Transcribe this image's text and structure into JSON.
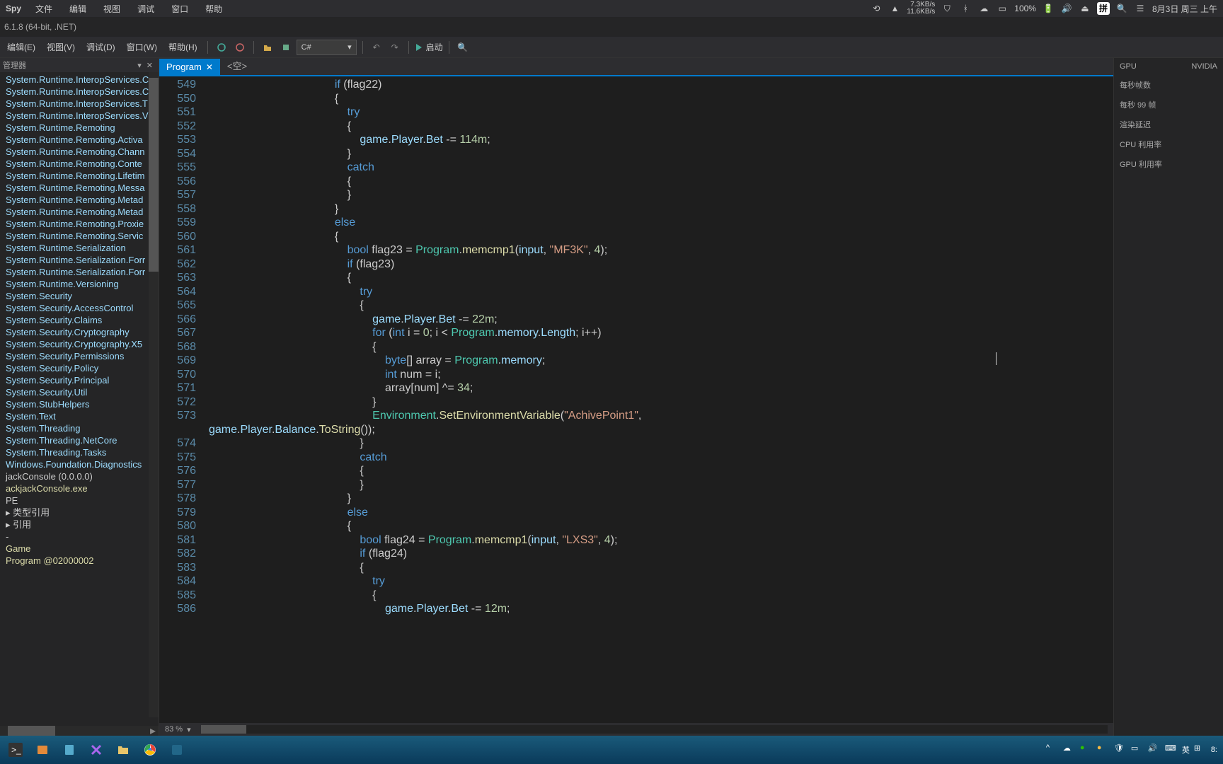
{
  "menubar": {
    "app": "Spy",
    "items": [
      "文件",
      "编辑",
      "视图",
      "调试",
      "窗口",
      "帮助"
    ],
    "net": {
      "up": "7.3KB/s",
      "down": "11.6KB/s"
    },
    "battery": "100%",
    "ime": "拼",
    "date": "8月3日 周三 上午"
  },
  "titlebar": {
    "text": "6.1.8 (64-bit, .NET)"
  },
  "menu2": {
    "items": [
      "编辑(E)",
      "视图(V)",
      "调试(D)",
      "窗口(W)",
      "帮助(H)"
    ],
    "lang": "C#",
    "start": "启动"
  },
  "panel": {
    "title": "管理器",
    "tree": [
      "System.Runtime.InteropServices.C",
      "System.Runtime.InteropServices.C",
      "System.Runtime.InteropServices.T",
      "System.Runtime.InteropServices.V",
      "System.Runtime.Remoting",
      "System.Runtime.Remoting.Activa",
      "System.Runtime.Remoting.Chann",
      "System.Runtime.Remoting.Conte",
      "System.Runtime.Remoting.Lifetim",
      "System.Runtime.Remoting.Messa",
      "System.Runtime.Remoting.Metad",
      "System.Runtime.Remoting.Metad",
      "System.Runtime.Remoting.Proxie",
      "System.Runtime.Remoting.Servic",
      "System.Runtime.Serialization",
      "System.Runtime.Serialization.Forr",
      "System.Runtime.Serialization.Forr",
      "System.Runtime.Versioning",
      "System.Security",
      "System.Security.AccessControl",
      "System.Security.Claims",
      "System.Security.Cryptography",
      "System.Security.Cryptography.X5",
      "System.Security.Permissions",
      "System.Security.Policy",
      "System.Security.Principal",
      "System.Security.Util",
      "System.StubHelpers",
      "System.Text",
      "System.Threading",
      "System.Threading.NetCore",
      "System.Threading.Tasks",
      "Windows.Foundation.Diagnostics"
    ],
    "tree2": [
      "jackConsole (0.0.0.0)",
      "ackjackConsole.exe",
      "   PE",
      "▸  类型引用",
      "▸  引用",
      "-",
      "   Game",
      "     Program @02000002"
    ]
  },
  "tabs": {
    "main": "Program",
    "second": "<空>"
  },
  "code": {
    "first_ln": 549,
    "zoom": "83 %"
  },
  "right": {
    "rows": [
      {
        "l": "GPU",
        "r": "NVIDIA"
      },
      {
        "l": "每秒帧数",
        "r": ""
      },
      {
        "l": "每秒 99 帧",
        "r": ""
      },
      {
        "l": "渲染延迟",
        "r": ""
      },
      {
        "l": "CPU 利用率",
        "r": ""
      },
      {
        "l": "GPU 利用率",
        "r": ""
      }
    ]
  },
  "taskbar": {
    "ime": "英",
    "time": "8:"
  }
}
